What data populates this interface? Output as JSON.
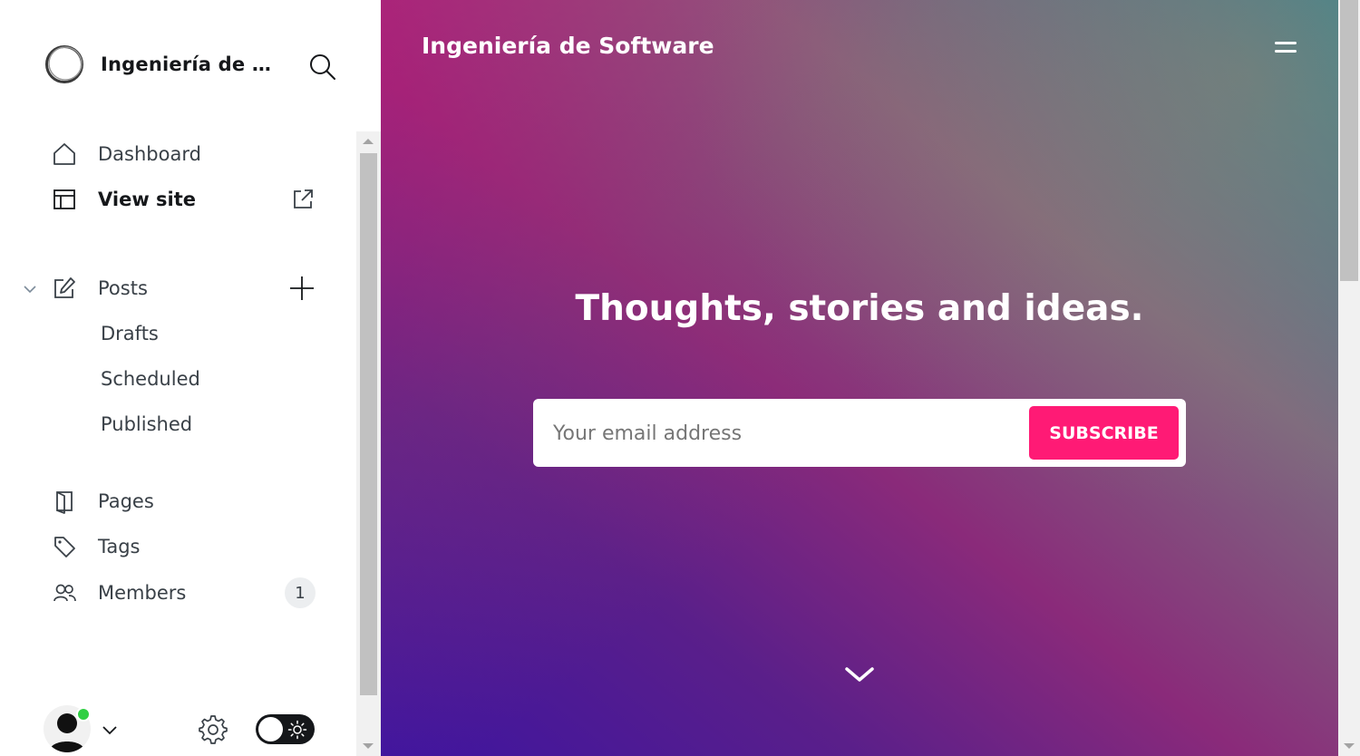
{
  "sidebar": {
    "brand_title": "Ingeniería de Software",
    "nav": {
      "dashboard": "Dashboard",
      "view_site": "View site",
      "posts": "Posts",
      "drafts": "Drafts",
      "scheduled": "Scheduled",
      "published": "Published",
      "pages": "Pages",
      "tags": "Tags",
      "members": "Members",
      "members_count": "1"
    },
    "icons": [
      "logo-ring-icon",
      "search-icon",
      "home-icon",
      "layout-icon",
      "external-link-icon",
      "chevron-down-icon",
      "edit-icon",
      "plus-icon",
      "page-icon",
      "tag-icon",
      "members-icon",
      "user-avatar-icon",
      "gear-icon",
      "sun-icon"
    ],
    "status_color": "#30cf43"
  },
  "preview": {
    "site_title": "Ingeniería de Software",
    "headline": "Thoughts, stories and ideas.",
    "email_placeholder": "Your email address",
    "subscribe_label": "SUBSCRIBE",
    "accent_color": "#ff1a75",
    "icons": [
      "hamburger-menu-icon",
      "chevron-down-icon"
    ]
  }
}
